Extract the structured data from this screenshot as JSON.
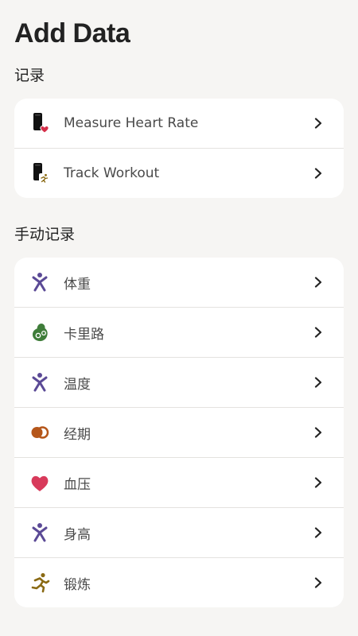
{
  "header": {
    "title": "Add Data"
  },
  "sections": [
    {
      "title": "记录",
      "items": [
        {
          "label": "Measure Heart Rate",
          "icon": "phone-heart-icon"
        },
        {
          "label": "Track Workout",
          "icon": "phone-workout-icon"
        }
      ]
    },
    {
      "title": "手动记录",
      "items": [
        {
          "label": "体重",
          "icon": "body-figure-icon"
        },
        {
          "label": "卡里路",
          "icon": "avocado-icon"
        },
        {
          "label": "温度",
          "icon": "body-figure-icon"
        },
        {
          "label": "经期",
          "icon": "cycle-circles-icon"
        },
        {
          "label": "血压",
          "icon": "heart-icon"
        },
        {
          "label": "身高",
          "icon": "body-figure-icon"
        },
        {
          "label": "锻炼",
          "icon": "running-figure-icon"
        }
      ]
    }
  ],
  "colors": {
    "background": "#f6f5f3",
    "card": "#ffffff",
    "figure_purple": "#5b4a96",
    "avocado_green": "#3f7d3a",
    "cycle_orange": "#b5561a",
    "heart_red": "#d83a5b",
    "runner_gold": "#8a6a14"
  }
}
